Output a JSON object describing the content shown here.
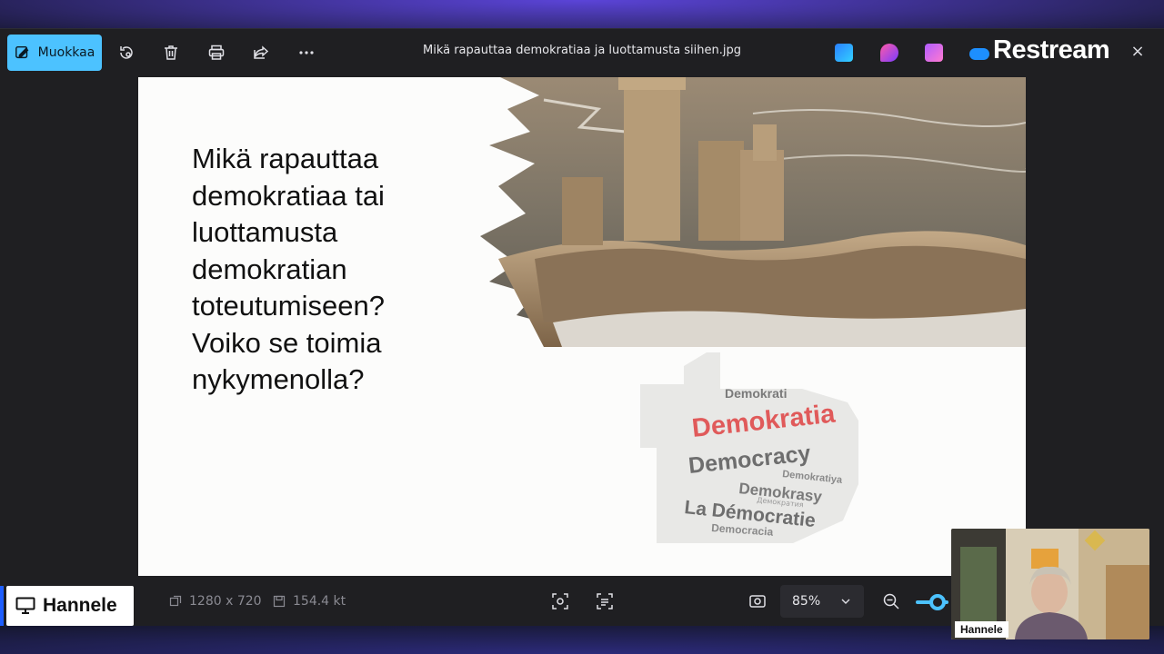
{
  "toolbar": {
    "edit_label": "Muokkaa",
    "filename": "Mikä rapauttaa demokratiaa ja luottamusta siihen.jpg",
    "brand": "Restream",
    "close_glyph": "×"
  },
  "slide": {
    "title": "Mikä rapauttaa\ndemokratiaa tai\nluottamusta\ndemokratian\ntoteutumiseen?\nVoiko se toimia\nnykymenolla?",
    "wordcloud": {
      "words": [
        "Demokratia",
        "Democracy",
        "Demokrasy",
        "La Démocratie",
        "Demokrati",
        "Demokratiya",
        "Democracia",
        "Демократия"
      ],
      "highlight_color": "#e05a5a",
      "text_color": "#6e6e6e"
    }
  },
  "statusbar": {
    "dimensions": "1280 x 720",
    "filesize": "154.4 kt",
    "zoom": "85%",
    "accent": "#4cc2ff"
  },
  "presenter": {
    "screen_label": "Hannele",
    "cam_label": "Hannele"
  }
}
